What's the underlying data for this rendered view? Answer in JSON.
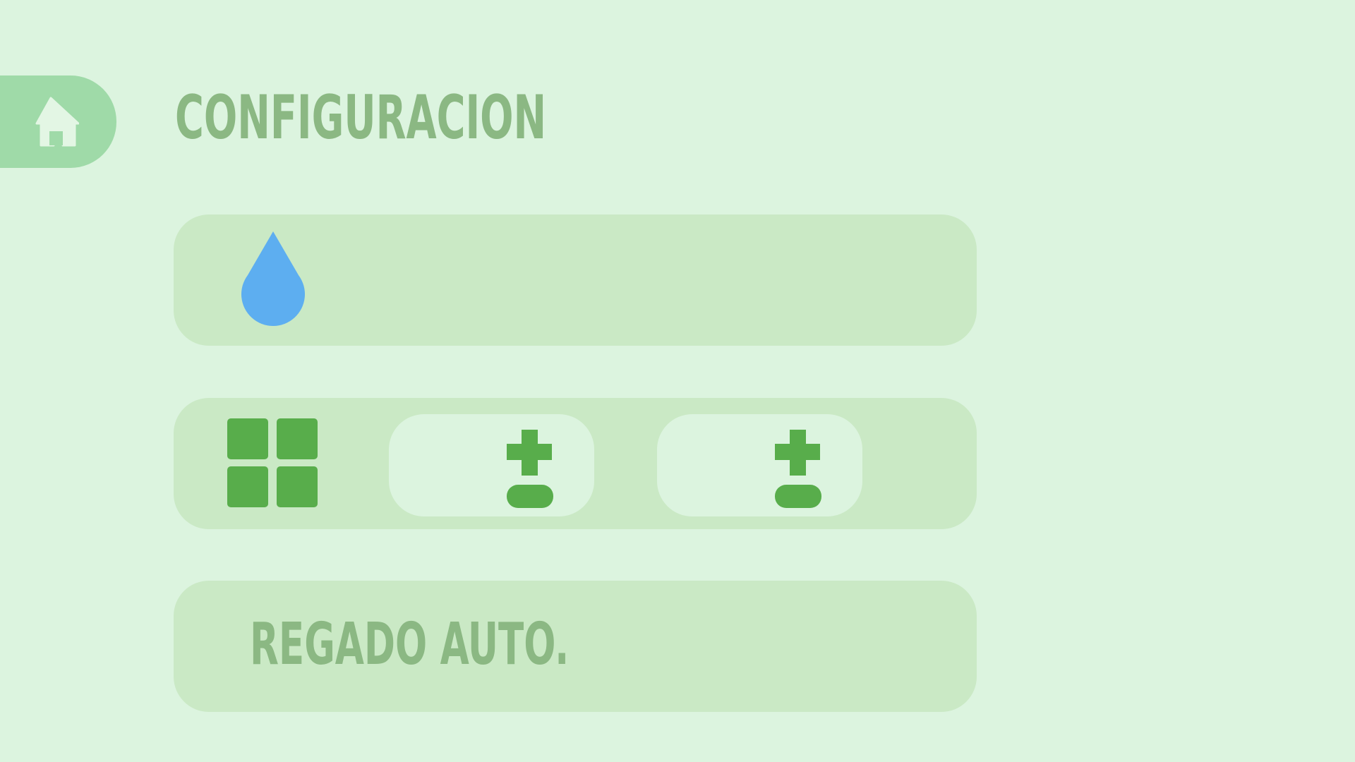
{
  "header": {
    "title": "CONFIGURACION",
    "home_icon": "home-icon"
  },
  "water_panel": {
    "icon": "water-drop-icon"
  },
  "size_panel": {
    "icon": "grid-icon",
    "steppers": [
      {
        "icon": "plus-minus-icon"
      },
      {
        "icon": "plus-minus-icon"
      }
    ]
  },
  "auto_panel": {
    "label": "REGADO AUTO."
  },
  "colors": {
    "background": "#dcf4df",
    "panel": "#cae9c5",
    "home_tab": "#9fdaa8",
    "title_text": "#8bb883",
    "accent_green": "#58ad4b",
    "water_blue": "#5daef0"
  }
}
